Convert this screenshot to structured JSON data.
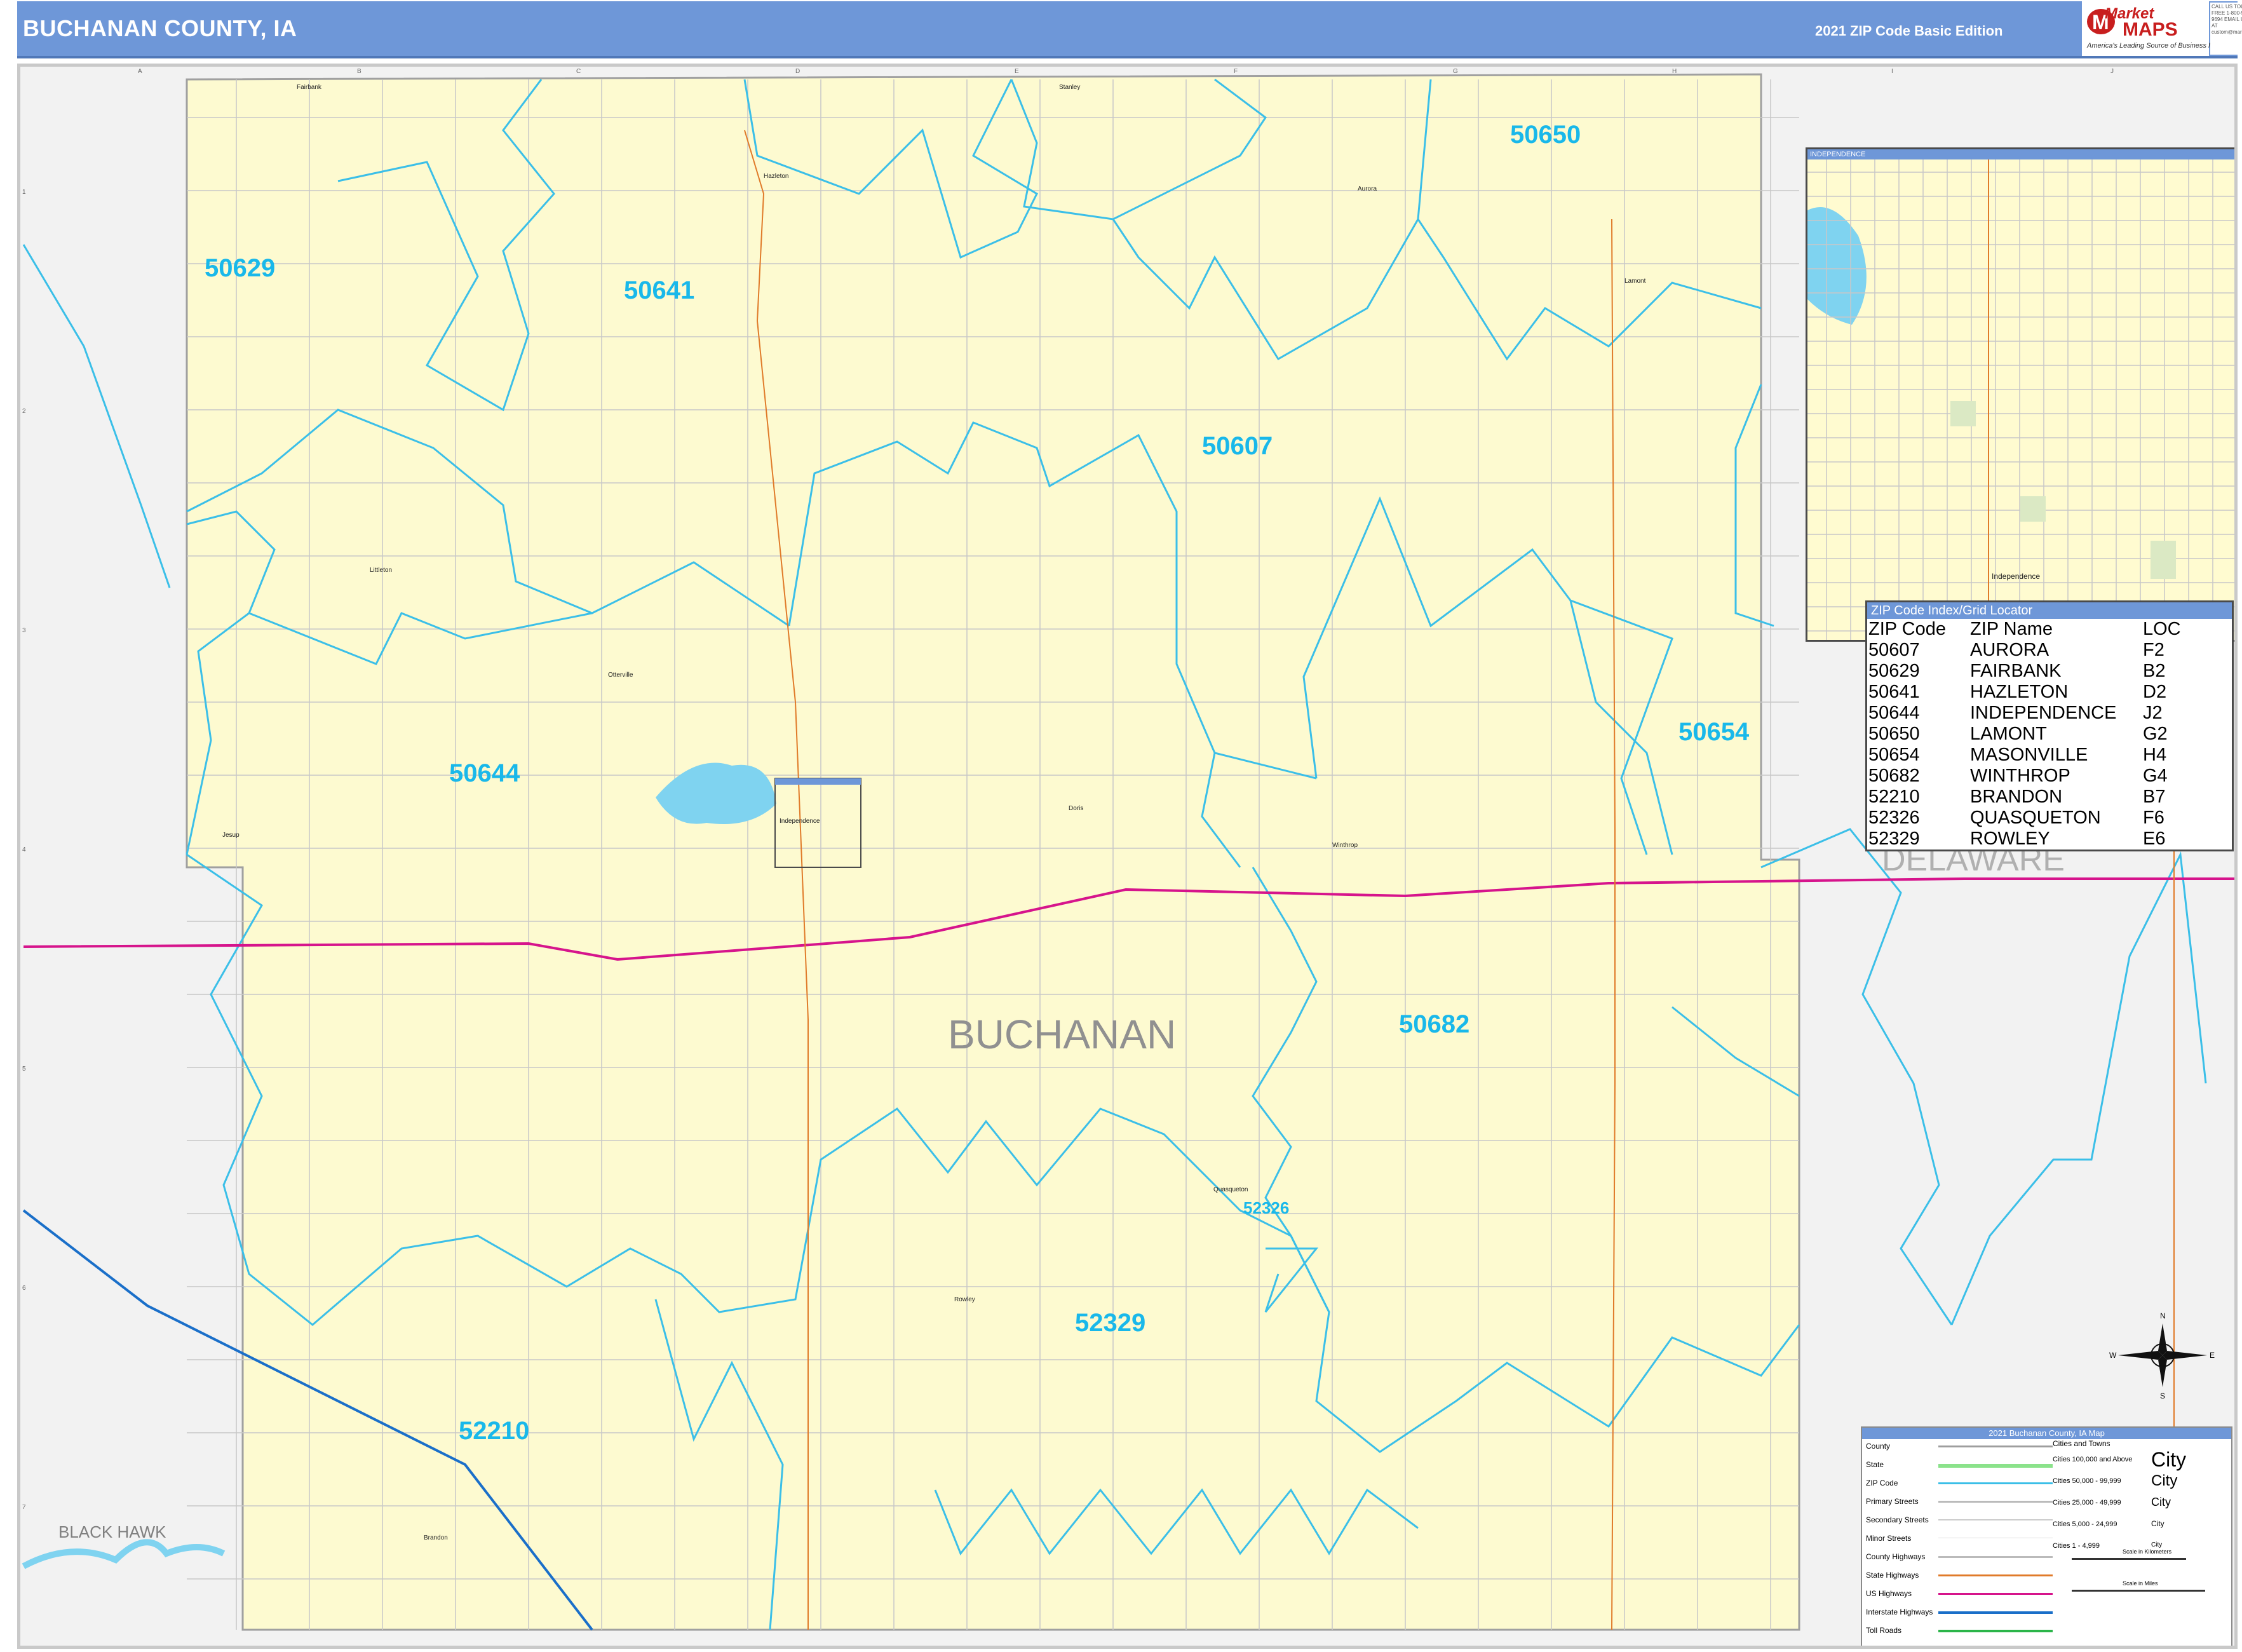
{
  "header": {
    "title": "BUCHANAN COUNTY, IA",
    "edition": "2021 ZIP Code Basic Edition"
  },
  "logo": {
    "word1": "Market",
    "word2": "MAPS",
    "tagline": "America's Leading Source of Business Maps",
    "contact": "CALL US TOLL FREE 1-800-594-9694 EMAIL US AT custom@marketmaps.com"
  },
  "colors": {
    "county_fill": "#fdfad0",
    "outside_fill": "#f2f2f2",
    "zip_boundary": "#3bbfe8",
    "us_highway": "#d6148c",
    "interstate": "#1a6fc9",
    "state_highway": "#e07b2a",
    "header": "#6e97d8"
  },
  "map": {
    "county_label": "BUCHANAN",
    "neighbor_labels": [
      "BLACK HAWK",
      "DELAWARE"
    ],
    "zip_labels": [
      {
        "zip": "50629"
      },
      {
        "zip": "50641"
      },
      {
        "zip": "50650"
      },
      {
        "zip": "50607"
      },
      {
        "zip": "50644"
      },
      {
        "zip": "50654"
      },
      {
        "zip": "50682"
      },
      {
        "zip": "52326"
      },
      {
        "zip": "52329"
      },
      {
        "zip": "52210"
      }
    ],
    "towns": [
      "Fairbank",
      "Hazleton",
      "Aurora",
      "Lamont",
      "Littleton",
      "Otterville",
      "Jesup",
      "Independence",
      "Doris",
      "Winthrop",
      "Quasqueton",
      "Rowley",
      "Brandon",
      "Stanley"
    ],
    "grid_columns": [
      "A",
      "B",
      "C",
      "D",
      "E",
      "F",
      "G",
      "H",
      "I",
      "J"
    ],
    "grid_rows": [
      "1",
      "2",
      "3",
      "4",
      "5",
      "6",
      "7"
    ],
    "compass": [
      "N",
      "E",
      "S",
      "W"
    ]
  },
  "inset": {
    "title": "INDEPENDENCE",
    "city_label": "Independence"
  },
  "zip_index": {
    "title": "ZIP Code Index/Grid Locator",
    "headers": [
      "ZIP Code",
      "ZIP Name",
      "LOC"
    ],
    "rows": [
      [
        "50607",
        "AURORA",
        "F2"
      ],
      [
        "50629",
        "FAIRBANK",
        "B2"
      ],
      [
        "50641",
        "HAZLETON",
        "D2"
      ],
      [
        "50644",
        "INDEPENDENCE",
        "J2"
      ],
      [
        "50650",
        "LAMONT",
        "G2"
      ],
      [
        "50654",
        "MASONVILLE",
        "H4"
      ],
      [
        "50682",
        "WINTHROP",
        "G4"
      ],
      [
        "52210",
        "BRANDON",
        "B7"
      ],
      [
        "52326",
        "QUASQUETON",
        "F6"
      ],
      [
        "52329",
        "ROWLEY",
        "E6"
      ]
    ]
  },
  "legend": {
    "title": "2021 Buchanan County, IA Map",
    "items": [
      "County",
      "State",
      "ZIP Code",
      "Primary Streets",
      "Secondary Streets",
      "Minor Streets",
      "County Highways",
      "State Highways",
      "US Highways",
      "Interstate Highways",
      "Toll Roads"
    ],
    "cities_header": "Cities and Towns",
    "city_sizes": [
      "Cities 100,000 and Above",
      "Cities 50,000 - 99,999",
      "Cities 25,000 - 49,999",
      "Cities 5,000 - 24,999",
      "Cities 1 - 4,999"
    ],
    "city_samples": [
      "City",
      "City",
      "City",
      "City",
      "City"
    ],
    "scale_km": "Scale in Kilometers",
    "scale_mi": "Scale in Miles"
  }
}
